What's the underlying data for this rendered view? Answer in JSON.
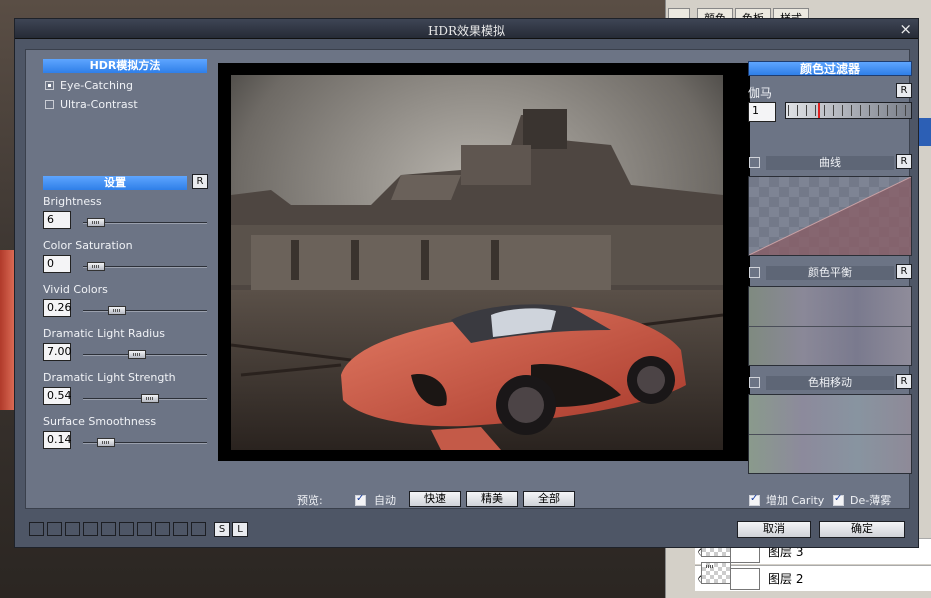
{
  "dialog": {
    "title": "HDR效果模拟",
    "close_symbol": "×"
  },
  "method": {
    "header": "HDR模拟方法",
    "options": [
      {
        "label": "Eye-Catching",
        "selected": true
      },
      {
        "label": "Ultra-Contrast",
        "selected": false
      }
    ]
  },
  "settings": {
    "header": "设置",
    "reset_label": "R",
    "sliders": [
      {
        "label": "Brightness",
        "value": "6",
        "fraction": 0.04
      },
      {
        "label": "Color Saturation",
        "value": "0",
        "fraction": 0.04
      },
      {
        "label": "Vivid Colors",
        "value": "0.26",
        "fraction": 0.24
      },
      {
        "label": "Dramatic Light Radius",
        "value": "7.00",
        "fraction": 0.42
      },
      {
        "label": "Dramatic Light Strength",
        "value": "0.54",
        "fraction": 0.55
      },
      {
        "label": "Surface Smoothness",
        "value": "0.14",
        "fraction": 0.13
      }
    ]
  },
  "preview_bar": {
    "label": "预览:",
    "auto_label": "自动",
    "auto_checked": true,
    "buttons": [
      "快速",
      "精美",
      "全部"
    ]
  },
  "filters": {
    "header": "颜色过滤器",
    "gamma_label": "伽马",
    "gamma_value": "1",
    "reset_label": "R",
    "sections": [
      "曲线",
      "颜色平衡",
      "色相移动"
    ]
  },
  "options": {
    "clarity_label": "增加 Carity",
    "clarity_checked": true,
    "dehaze_label": "De-薄雾",
    "dehaze_checked": true
  },
  "footer": {
    "preset_count": 10,
    "s_label": "S",
    "l_label": "L",
    "cancel_label": "取消",
    "ok_label": "确定"
  },
  "host_app": {
    "tabs": [
      "颜色",
      "色板",
      "样式"
    ],
    "layer_name": "图层 2",
    "layer_name_partial": "图层 3"
  },
  "colors": {
    "accent": "#3d8cf5",
    "panel": "#6c7485",
    "frame": "#4e5666"
  }
}
